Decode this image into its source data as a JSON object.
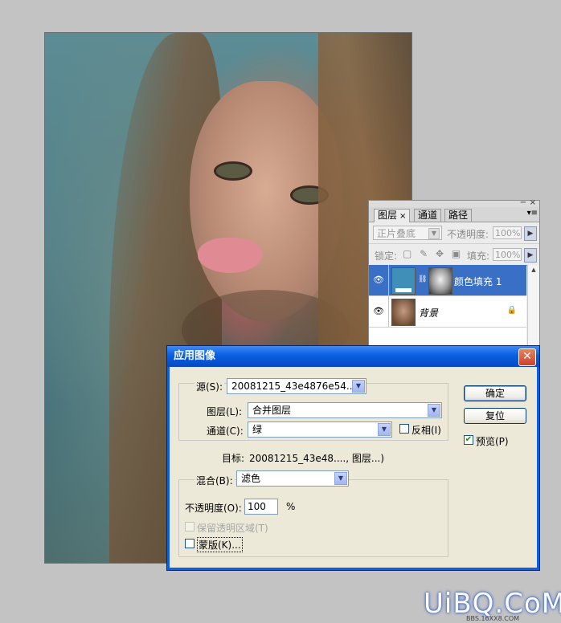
{
  "layers_panel": {
    "tabs": [
      "图层",
      "通道",
      "路径"
    ],
    "tab_close": "×",
    "minimize": "−",
    "close": "×",
    "menu": "▾≡",
    "blend_mode": "正片叠底",
    "opacity_label": "不透明度:",
    "opacity_value": "100%",
    "lock_label": "锁定:",
    "fill_label": "填充:",
    "fill_value": "100%",
    "layers": [
      {
        "name": "颜色填充 1",
        "selected": true
      },
      {
        "name": "背景",
        "selected": false
      }
    ]
  },
  "dialog": {
    "title": "应用图像",
    "close": "✕",
    "source_label": "源(S):",
    "source_value": "20081215_43e4876e54...",
    "layer_label": "图层(L):",
    "layer_value": "合并图层",
    "channel_label": "通道(C):",
    "channel_value": "绿",
    "invert_label": "反相(I)",
    "target_label": "目标:",
    "target_value": "20081215_43e48...., 图层...)",
    "blend_label": "混合(B):",
    "blend_value": "滤色",
    "opacity_label": "不透明度(O):",
    "opacity_value": "100",
    "opacity_unit": "%",
    "preserve_label": "保留透明区域(T)",
    "mask_label": "蒙版(K)...",
    "ok_label": "确定",
    "reset_label": "复位",
    "preview_label": "预览(P)",
    "preview_checked": true
  },
  "watermark": {
    "logo": "UiBQ.CoM",
    "sub": "BBS.16XX8.COM"
  },
  "colors": {
    "titlebar": "#0a5fe0",
    "selected_layer": "#3a6fc6",
    "fill_swatch": "#3f8fb8"
  }
}
